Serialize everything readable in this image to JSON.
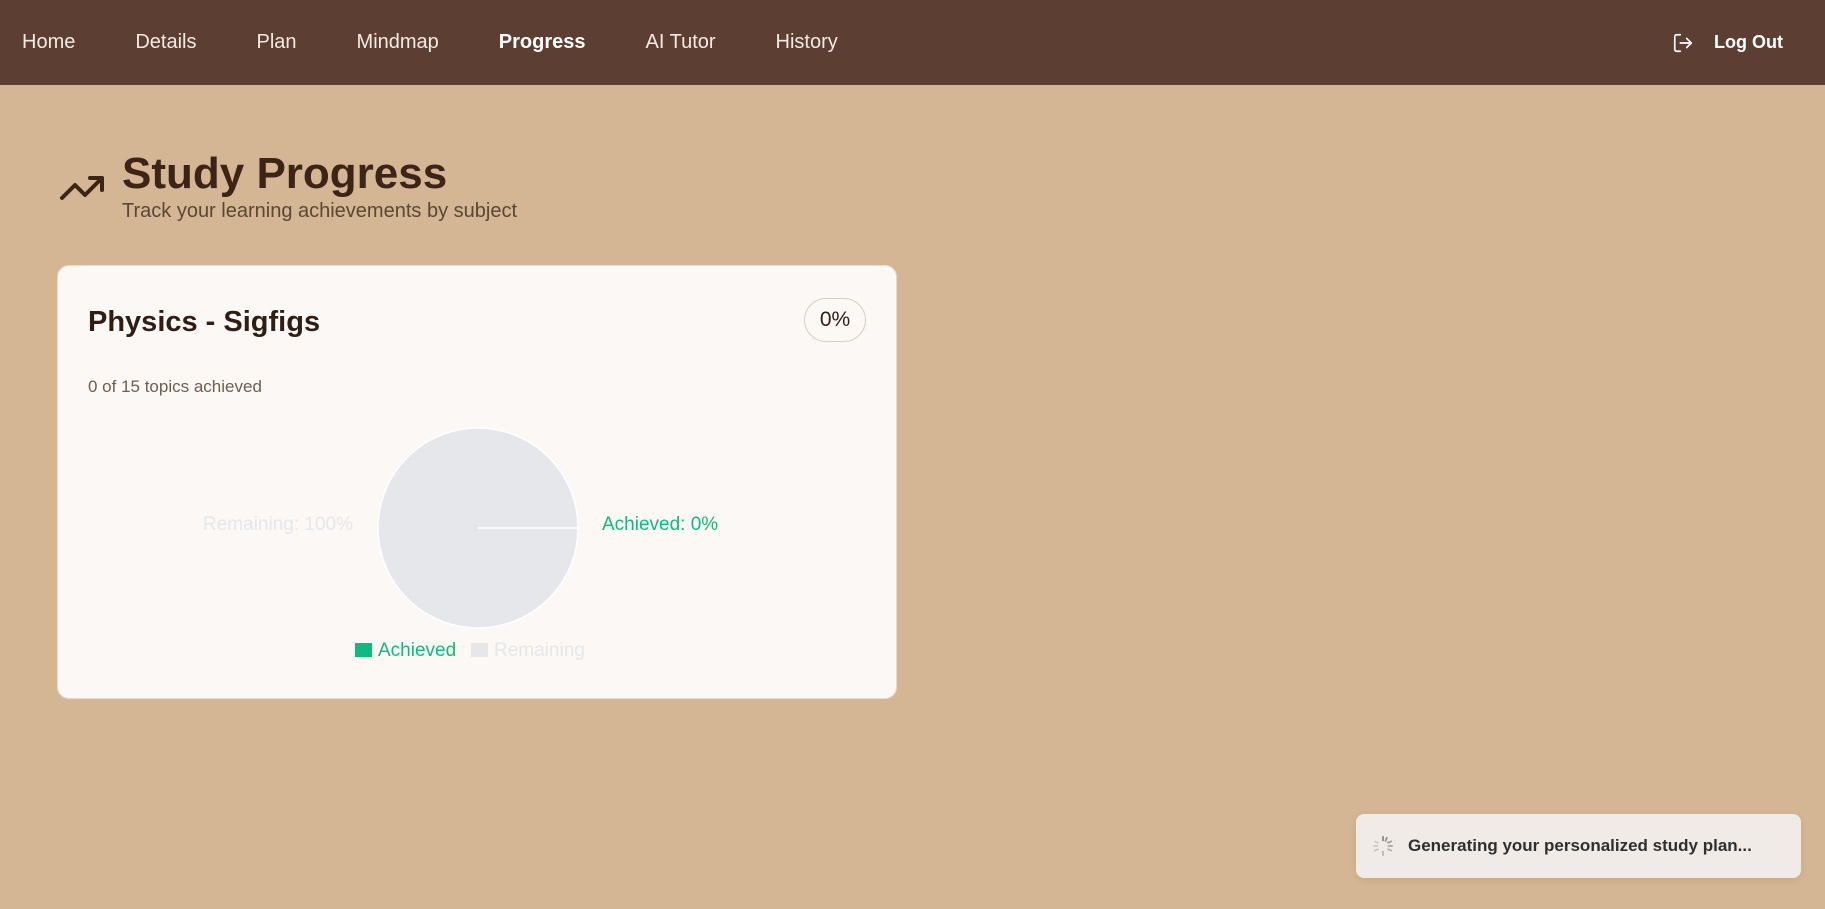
{
  "nav": {
    "items": [
      {
        "label": "Home",
        "active": false
      },
      {
        "label": "Details",
        "active": false
      },
      {
        "label": "Plan",
        "active": false
      },
      {
        "label": "Mindmap",
        "active": false
      },
      {
        "label": "Progress",
        "active": true
      },
      {
        "label": "AI Tutor",
        "active": false
      },
      {
        "label": "History",
        "active": false
      }
    ],
    "logout_label": "Log Out",
    "logout_icon": "logout-icon"
  },
  "header": {
    "icon": "trending-up-icon",
    "title": "Study Progress",
    "subtitle": "Track your learning achievements by subject"
  },
  "subject_card": {
    "title": "Physics - Sigfigs",
    "percent_badge": "0%",
    "topics_summary": "0 of 15 topics achieved"
  },
  "chart_data": {
    "type": "pie",
    "categories": [
      "Achieved",
      "Remaining"
    ],
    "values": [
      0,
      100
    ],
    "slice_labels": [
      "Achieved: 0%",
      "Remaining: 100%"
    ],
    "legend": [
      "Achieved",
      "Remaining"
    ],
    "legend_placement": "bottom",
    "colors": {
      "Achieved": "#10b981",
      "Remaining": "#e5e7eb"
    }
  },
  "toast": {
    "icon": "spinner-icon",
    "message": "Generating your personalized study plan..."
  },
  "colors": {
    "nav_bg": "#5c3e33",
    "page_bg": "#d4b694",
    "card_bg": "#fbf8f5",
    "accent_green": "#10b981"
  }
}
